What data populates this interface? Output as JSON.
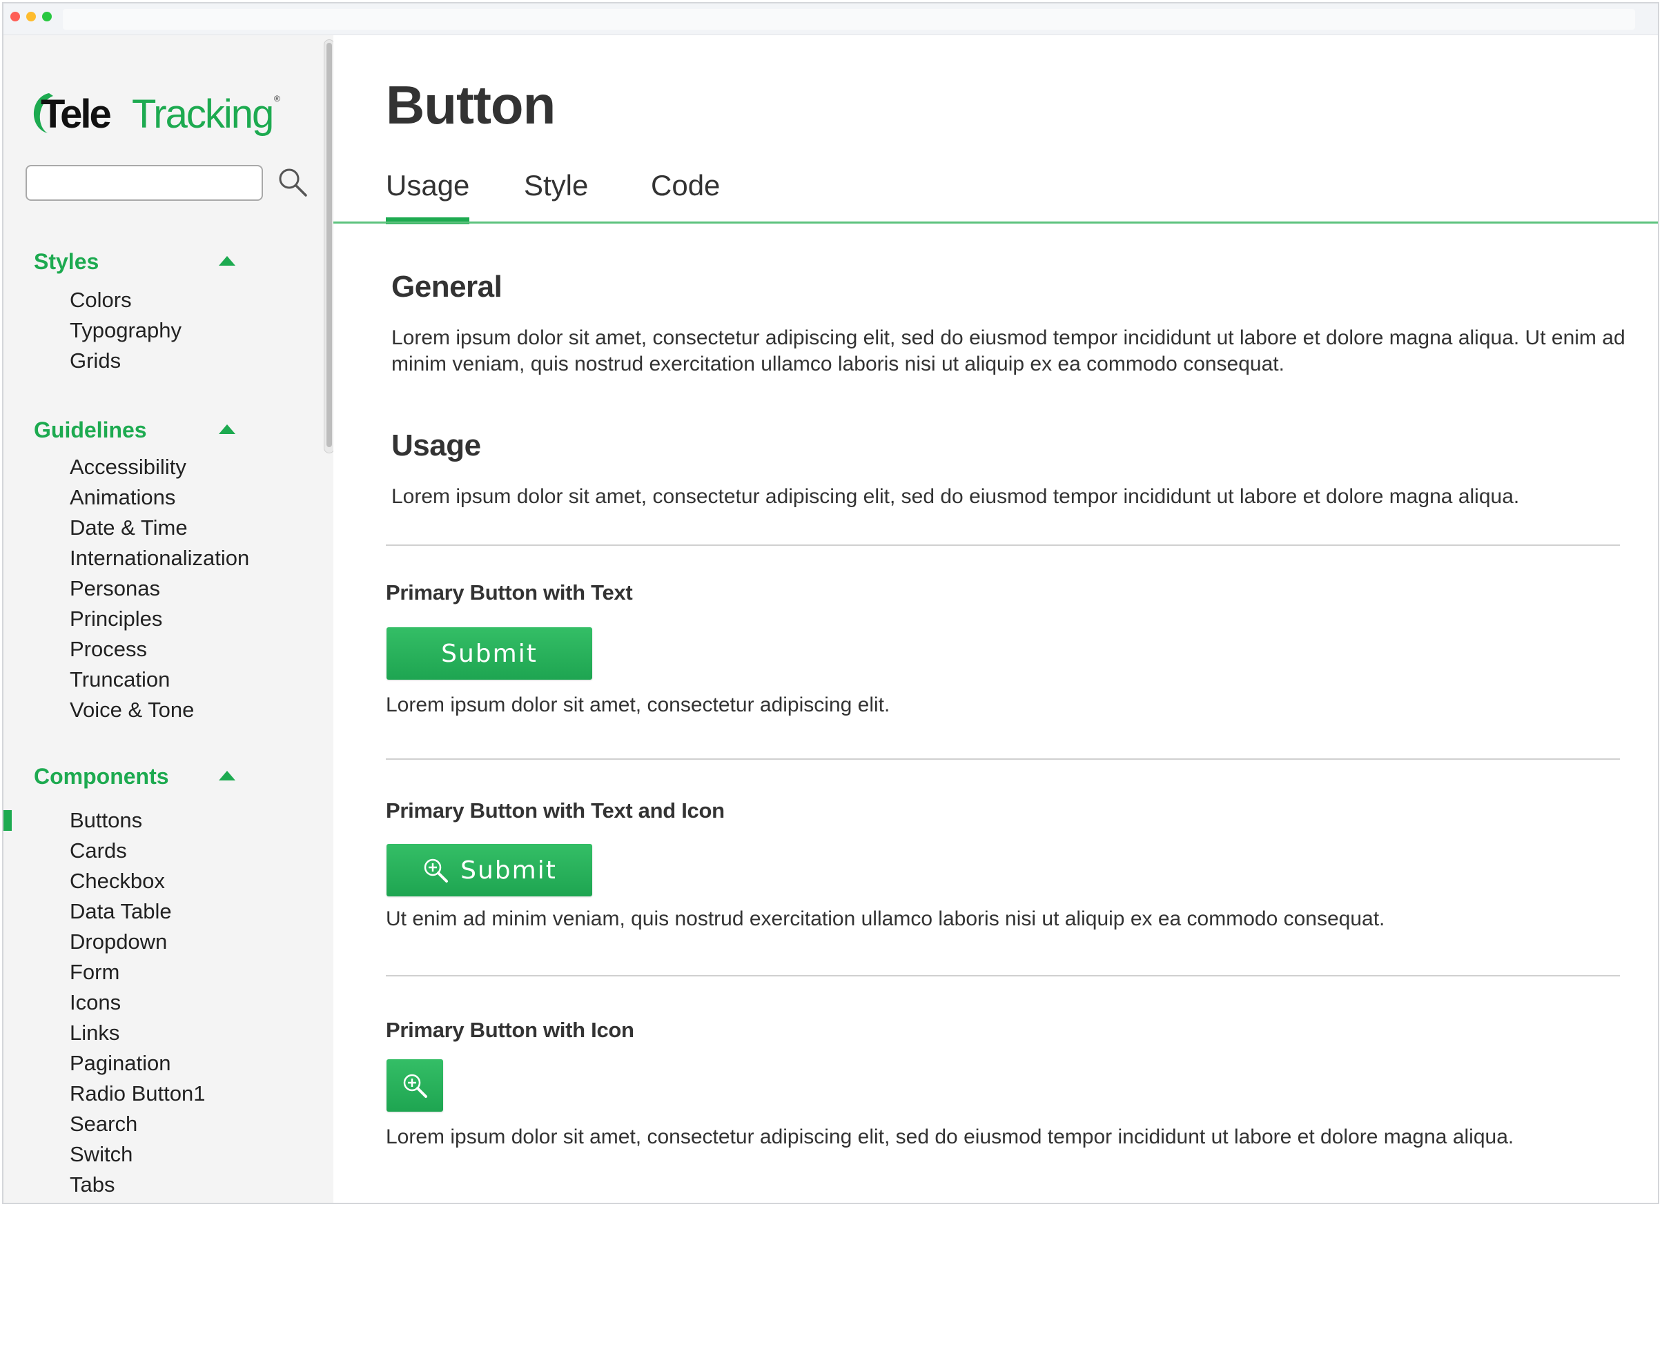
{
  "logo": {
    "text_tele": "Tele",
    "text_tracking": "Tracking",
    "registered": "®",
    "brand_color": "#1daa50"
  },
  "search": {
    "value": "",
    "placeholder": ""
  },
  "sidebar": {
    "sections": [
      {
        "title": "Styles",
        "expanded": true,
        "items": [
          "Colors",
          "Typography",
          "Grids"
        ]
      },
      {
        "title": "Guidelines",
        "expanded": true,
        "items": [
          "Accessibility",
          "Animations",
          "Date & Time",
          "Internationalization",
          "Personas",
          "Principles",
          "Process",
          "Truncation",
          "Voice & Tone"
        ]
      },
      {
        "title": "Components",
        "expanded": true,
        "items": [
          "Buttons",
          "Cards",
          "Checkbox",
          "Data Table",
          "Dropdown",
          "Form",
          "Icons",
          "Links",
          "Pagination",
          "Radio Button1",
          "Search",
          "Switch",
          "Tabs"
        ],
        "active_item": "Buttons"
      }
    ]
  },
  "page": {
    "title": "Button",
    "tabs": [
      {
        "label": "Usage",
        "active": true
      },
      {
        "label": "Style",
        "active": false
      },
      {
        "label": "Code",
        "active": false
      }
    ]
  },
  "content": {
    "general": {
      "heading": "General",
      "text": "Lorem ipsum dolor sit amet, consectetur adipiscing elit, sed do eiusmod tempor incididunt ut labore et dolore magna aliqua. Ut enim ad minim veniam, quis nostrud exercitation ullamco laboris nisi ut aliquip ex ea commodo consequat."
    },
    "usage": {
      "heading": "Usage",
      "text": "Lorem ipsum dolor sit amet, consectetur adipiscing elit, sed do eiusmod tempor incididunt ut labore et dolore magna aliqua."
    },
    "examples": [
      {
        "heading": "Primary Button with Text",
        "button_label": "Submit",
        "icon": "search-plus-icon",
        "caption": "Lorem ipsum dolor sit amet, consectetur adipiscing elit."
      },
      {
        "heading": "Primary Button with Text and Icon",
        "button_label": "Submit",
        "icon": "search-plus-icon",
        "caption": "Ut enim ad minim veniam, quis nostrud exercitation ullamco laboris nisi ut aliquip ex ea commodo consequat."
      },
      {
        "heading": "Primary Button with Icon",
        "button_label": "",
        "icon": "search-plus-icon",
        "caption": "Lorem ipsum dolor sit amet, consectetur adipiscing elit, sed do eiusmod tempor incididunt ut labore et dolore magna aliqua."
      }
    ]
  },
  "colors": {
    "accent": "#1daa50",
    "text": "#333333",
    "sidebar_bg": "#f4f4f4"
  }
}
